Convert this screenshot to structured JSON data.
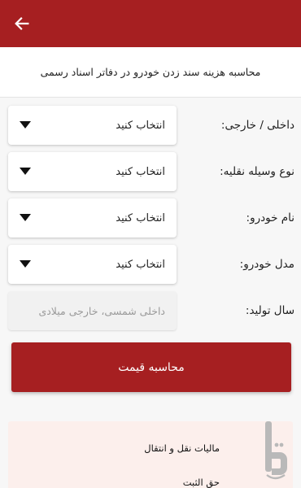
{
  "header": {
    "back_icon": "arrow-left-icon",
    "background_color": "#a61f21"
  },
  "subtitle": "محاسبه هزینه سند زدن خودرو در دفاتر اسناد رسمی",
  "form": {
    "fields": [
      {
        "label": "داخلی / خارجی:",
        "value": "انتخاب کنید"
      },
      {
        "label": "نوع وسیله نقلیه:",
        "value": "انتخاب کنید"
      },
      {
        "label": "نام خودرو:",
        "value": "انتخاب کنید"
      },
      {
        "label": "مدل خودرو:",
        "value": "انتخاب کنید"
      }
    ],
    "year": {
      "label": "سال تولید:",
      "placeholder": "داخلی شمسی، خارجی میلادی"
    }
  },
  "calculate_button": "محاسبه قیمت",
  "results": {
    "lines": [
      "مالیات نقل و انتقال",
      "حق الثبت"
    ]
  },
  "accent_color": "#a61f21"
}
